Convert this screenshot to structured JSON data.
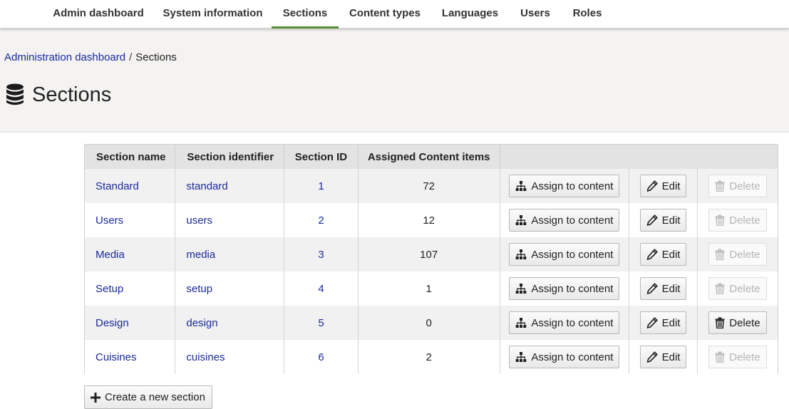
{
  "nav": {
    "tabs": [
      {
        "label": "Admin dashboard"
      },
      {
        "label": "System information"
      },
      {
        "label": "Sections"
      },
      {
        "label": "Content types"
      },
      {
        "label": "Languages"
      },
      {
        "label": "Users"
      },
      {
        "label": "Roles"
      }
    ],
    "active_tab": "Sections"
  },
  "breadcrumb": {
    "parent": "Administration dashboard",
    "separator": "/",
    "current": "Sections"
  },
  "page": {
    "title": "Sections",
    "title_icon": "database-icon"
  },
  "table": {
    "headers": {
      "name": "Section name",
      "identifier": "Section identifier",
      "id": "Section ID",
      "count": "Assigned Content items"
    },
    "rows": [
      {
        "name": "Standard",
        "identifier": "standard",
        "id": "1",
        "count": "72",
        "assign": "Assign to content",
        "edit": "Edit",
        "delete": "Delete",
        "delete_enabled": false
      },
      {
        "name": "Users",
        "identifier": "users",
        "id": "2",
        "count": "12",
        "assign": "Assign to content",
        "edit": "Edit",
        "delete": "Delete",
        "delete_enabled": false
      },
      {
        "name": "Media",
        "identifier": "media",
        "id": "3",
        "count": "107",
        "assign": "Assign to content",
        "edit": "Edit",
        "delete": "Delete",
        "delete_enabled": false
      },
      {
        "name": "Setup",
        "identifier": "setup",
        "id": "4",
        "count": "1",
        "assign": "Assign to content",
        "edit": "Edit",
        "delete": "Delete",
        "delete_enabled": false
      },
      {
        "name": "Design",
        "identifier": "design",
        "id": "5",
        "count": "0",
        "assign": "Assign to content",
        "edit": "Edit",
        "delete": "Delete",
        "delete_enabled": true
      },
      {
        "name": "Cuisines",
        "identifier": "cuisines",
        "id": "6",
        "count": "2",
        "assign": "Assign to content",
        "edit": "Edit",
        "delete": "Delete",
        "delete_enabled": false
      }
    ]
  },
  "actions": {
    "create_label": "Create a new section"
  },
  "colors": {
    "link": "#1a2a9b",
    "active_tab_underline": "#5a8f3a",
    "header_bg": "#f4f3f2"
  }
}
